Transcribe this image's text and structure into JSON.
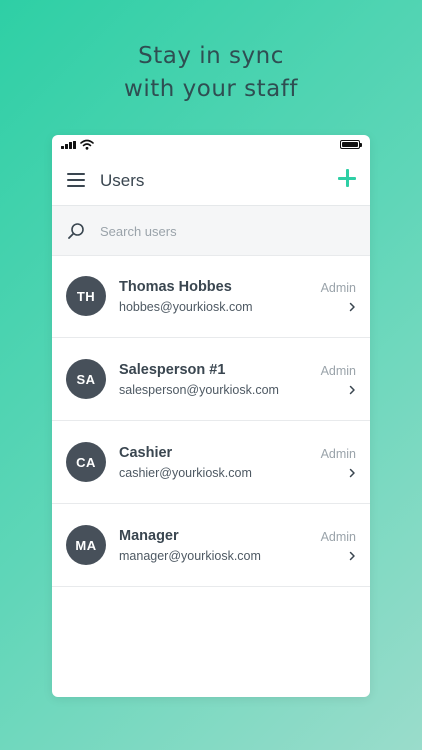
{
  "headline": {
    "line1": "Stay in sync",
    "line2": "with your staff"
  },
  "colors": {
    "accent": "#2ecfa5",
    "avatar_bg": "#47505a",
    "text_primary": "#3a4650",
    "text_muted": "#9aa3aa"
  },
  "app_bar": {
    "title": "Users",
    "menu_icon": "hamburger-menu-icon",
    "add_icon": "plus-icon"
  },
  "search": {
    "placeholder": "Search users",
    "icon": "search-icon"
  },
  "users": [
    {
      "initials": "TH",
      "name": "Thomas Hobbes",
      "email": "hobbes@yourkiosk.com",
      "role": "Admin"
    },
    {
      "initials": "SA",
      "name": "Salesperson #1",
      "email": "salesperson@yourkiosk.com",
      "role": "Admin"
    },
    {
      "initials": "CA",
      "name": "Cashier",
      "email": "cashier@yourkiosk.com",
      "role": "Admin"
    },
    {
      "initials": "MA",
      "name": "Manager",
      "email": "manager@yourkiosk.com",
      "role": "Admin"
    }
  ]
}
